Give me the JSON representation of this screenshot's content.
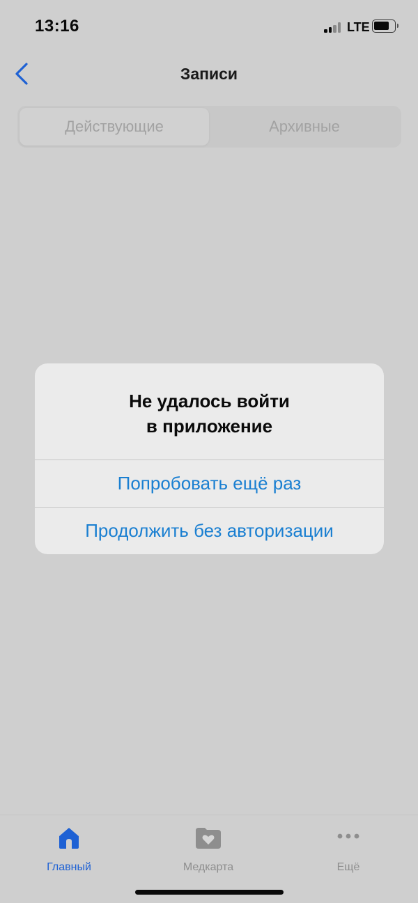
{
  "status_bar": {
    "time": "13:16",
    "network": "LTE",
    "icons": [
      "signal-icon",
      "battery-icon"
    ]
  },
  "nav": {
    "title": "Записи",
    "back_icon": "chevron-left-icon"
  },
  "segments": [
    {
      "label": "Действующие",
      "selected": true
    },
    {
      "label": "Архивные",
      "selected": false
    }
  ],
  "alert": {
    "title_line1": "Не удалось войти",
    "title_line2": "в приложение",
    "buttons": [
      {
        "label": "Попробовать ещё раз"
      },
      {
        "label": "Продолжить без авторизации"
      }
    ]
  },
  "tabbar": {
    "items": [
      {
        "label": "Главный",
        "icon": "home-icon",
        "active": true
      },
      {
        "label": "Медкарта",
        "icon": "medcard-icon",
        "active": false
      },
      {
        "label": "Ещё",
        "icon": "more-icon",
        "active": false
      }
    ]
  },
  "colors": {
    "accent": "#1a7fd1",
    "tab_active": "#1e61d4",
    "background": "#cfcfcf",
    "alert_bg": "#ebebeb"
  }
}
